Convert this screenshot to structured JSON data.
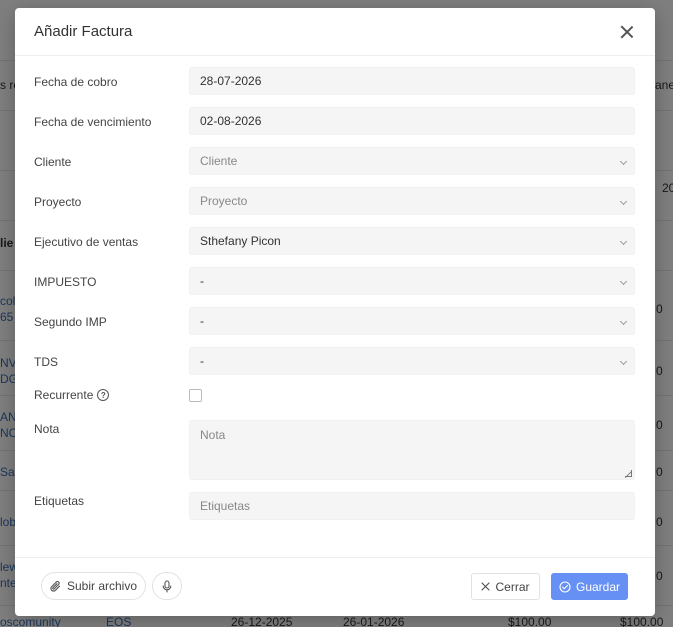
{
  "background": {
    "left_fragments": [
      "s re",
      "lie",
      "colo",
      "65",
      "NVE",
      "DG",
      "AN",
      "NC.",
      "San",
      "lob",
      "lew",
      "nter",
      "oscomunity"
    ],
    "right_fragments": [
      "anej",
      "20",
      "0",
      "0",
      "0",
      "0",
      "0",
      "0"
    ],
    "bottom_row": {
      "col2": "EOS",
      "col3": "26-12-2025",
      "col4": "26-01-2026",
      "col5": "$100.00",
      "col6": "$100.00"
    }
  },
  "modal": {
    "title": "Añadir Factura",
    "fields": {
      "fecha_cobro": {
        "label": "Fecha de cobro",
        "value": "28-07-2026"
      },
      "fecha_vencimiento": {
        "label": "Fecha de vencimiento",
        "value": "02-08-2026"
      },
      "cliente": {
        "label": "Cliente",
        "value": "Cliente"
      },
      "proyecto": {
        "label": "Proyecto",
        "value": "Proyecto"
      },
      "ejecutivo": {
        "label": "Ejecutivo de ventas",
        "value": "Sthefany Picon"
      },
      "impuesto": {
        "label": "IMPUESTO",
        "value": "-"
      },
      "segundo_imp": {
        "label": "Segundo IMP",
        "value": "-"
      },
      "tds": {
        "label": "TDS",
        "value": "-"
      },
      "recurrente": {
        "label": "Recurrente",
        "checked": false
      },
      "nota": {
        "label": "Nota",
        "placeholder": "Nota"
      },
      "etiquetas": {
        "label": "Etiquetas",
        "placeholder": "Etiquetas"
      }
    },
    "footer": {
      "upload_label": "Subir archivo",
      "close_label": "Cerrar",
      "save_label": "Guardar"
    },
    "colors": {
      "primary": "#6690f4"
    }
  }
}
